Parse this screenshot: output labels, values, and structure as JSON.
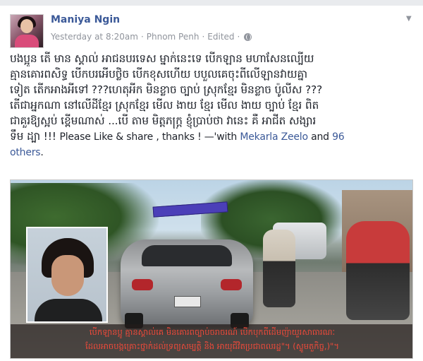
{
  "post": {
    "author": "Maniya Ngin",
    "timestamp": "Yesterday at 8:20am",
    "location": "Phnom Penh",
    "edited": "Edited",
    "separator": "·",
    "lines": [
      "បងប្អូន តើ មាន ស្គាល់ អាជនបរទេស ម្នាក់នេះទេ បើកឡាន មហាសែនល្បើយ",
      "គ្មានគោរពសិទ្ធ បើកបរអើបថ្លិច បើកខុសហើយ បបួលគេចុះពីលើឡានវាយគ្នា",
      "ទៀត តើកអាងអីទៅ ???ហេតុអីក មិនខ្លាច ច្បាប់ ស្រុកខ្មែរ មិនខ្លាច ប៉ូលីស ???",
      "តើជាអ្នកណា នៅលើដីខ្មែរ ស្រុកខ្មែរ មើល ងាយ ខ្មែរ មើល ងាយ ច្បាប់ ខ្មែរ ពិត",
      "ជាគួរឱ្យស្អប់ ខ្ពើមណាស់ ...បើ តាម មិត្តភក្ត្រ ខ្ញុំប្រាប់ថា វានេះ គឺ អាជីត សង្សារ"
    ],
    "last_line_kh": "ទឹម ដ្បា !!! ",
    "last_line_en": "Please Like & share , thanks ! —'with ",
    "tag_link_1": "Mekarla Zeelo",
    "tag_and": " and ",
    "tag_link_2_a": "96",
    "tag_link_2_b": "others",
    "tag_end": "."
  },
  "photo": {
    "caption_line_1": "បើកឡានប្អូ គ្មានស្គាល់គេ មិនគោរពច្បាប់ចរាចរណ៍ បើកបុកពីដើមញ៉ាយួរសាធារណៈ",
    "caption_line_2": "ដែលអាចបង្កគ្រោះថ្នាក់ដល់ទ្រព្យសម្បត្តិ និង អាយុជីវិតប្រជាពលរដ្ឋ\"។ (ស្ទូមតួកិច្ច,)\"។"
  },
  "icons": {
    "menu": "chevron-down-icon",
    "privacy": "globe-icon"
  },
  "colors": {
    "link": "#3b5998",
    "meta": "#90949c",
    "caption": "#f04a3a"
  }
}
